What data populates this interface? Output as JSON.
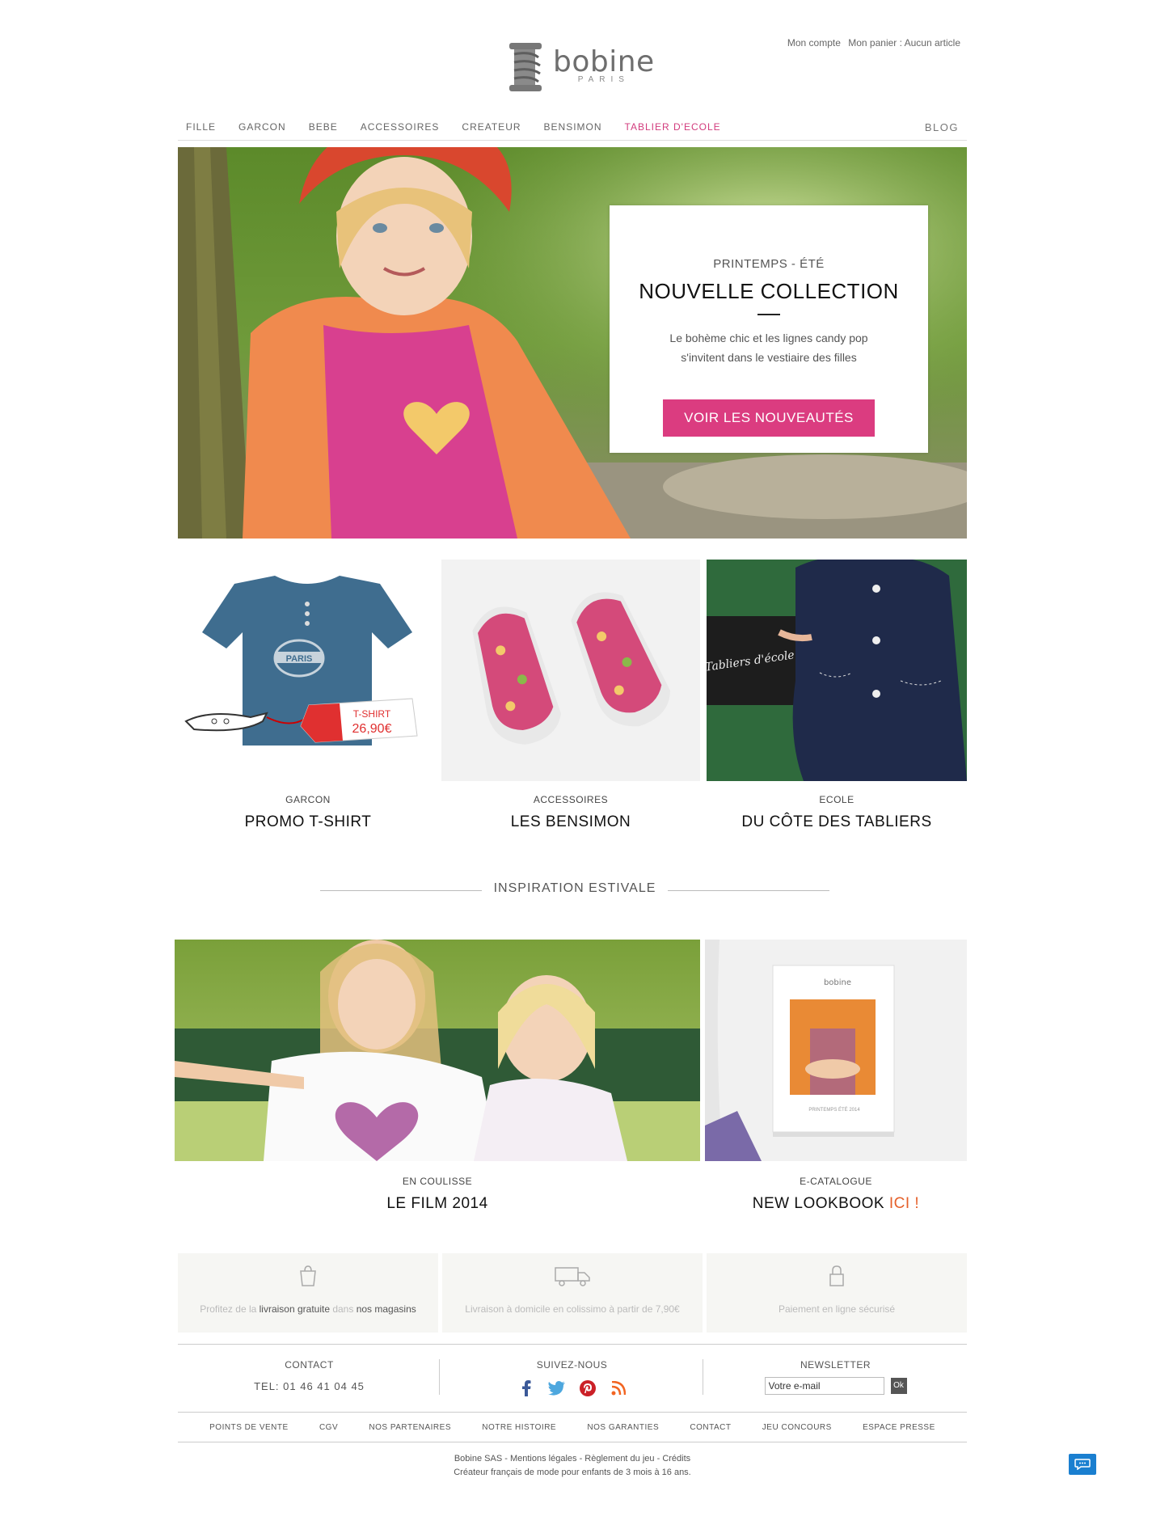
{
  "header": {
    "account_label": "Mon compte",
    "cart_label": "Mon panier : Aucun article",
    "logo": {
      "name": "bobine",
      "sub": "PARIS"
    }
  },
  "nav": {
    "items": [
      {
        "label": "FILLE"
      },
      {
        "label": "GARCON"
      },
      {
        "label": "BEBE"
      },
      {
        "label": "ACCESSOIRES"
      },
      {
        "label": "CREATEUR"
      },
      {
        "label": "BENSIMON"
      },
      {
        "label": "TABLIER D'ECOLE"
      }
    ],
    "blog": "BLOG",
    "active_color": "#d23c7d"
  },
  "hero": {
    "season": "PRINTEMPS - ÉTÉ",
    "title": "NOUVELLE COLLECTION",
    "text_line1": "Le bohème chic et les lignes candy pop",
    "text_line2": "s'invitent dans le vestiaire des filles",
    "button": "VOIR LES NOUVEAUTÉS",
    "button_color": "#db3c80"
  },
  "tiles": [
    {
      "category": "GARCON",
      "title": "PROMO T-SHIRT",
      "tag_label": "T-SHIRT",
      "tag_price": "26,90€",
      "stamp": "PARIS"
    },
    {
      "category": "ACCESSOIRES",
      "title": "LES BENSIMON"
    },
    {
      "category": "ECOLE",
      "title": "DU CÔTE DES TABLIERS",
      "board_text": "Tabliers d'école"
    }
  ],
  "inspiration": {
    "heading": "INSPIRATION ESTIVALE",
    "left": {
      "category": "EN COULISSE",
      "title": "LE FILM 2014"
    },
    "right": {
      "category": "E-CATALOGUE",
      "title": "NEW LOOKBOOK ",
      "highlight": "ICI !",
      "highlight_color": "#e5602a",
      "catalog_brand": "bobine",
      "catalog_caption": "PRINTEMPS ÉTÉ 2014"
    }
  },
  "features": {
    "f1": {
      "p1": "Profitez de la ",
      "b1": "livraison gratuite",
      "p2": " dans ",
      "b2": "nos magasins"
    },
    "f2": {
      "text": "Livraison à domicile en colissimo à partir de 7,90€"
    },
    "f3": {
      "text": "Paiement en ligne sécurisé"
    }
  },
  "footer": {
    "contact_title": "CONTACT",
    "tel": "TEL: 01 46 41 04 45",
    "follow_title": "SUIVEZ-NOUS",
    "social_icons": [
      "facebook-icon",
      "twitter-icon",
      "pinterest-icon",
      "rss-icon"
    ],
    "newsletter_title": "NEWSLETTER",
    "newsletter_value": "Votre e-mail",
    "newsletter_button": "Ok",
    "links": [
      "POINTS DE VENTE",
      "CGV",
      "NOS PARTENAIRES",
      "NOTRE HISTOIRE",
      "NOS GARANTIES",
      "CONTACT",
      "JEU CONCOURS",
      "ESPACE PRESSE"
    ],
    "legal": {
      "company": "Bobine SAS",
      "mentions": "Mentions légales",
      "rules": "Règlement du jeu",
      "credits": "Crédits",
      "tagline": "Créateur français de mode pour enfants de 3 mois à 16 ans."
    }
  }
}
